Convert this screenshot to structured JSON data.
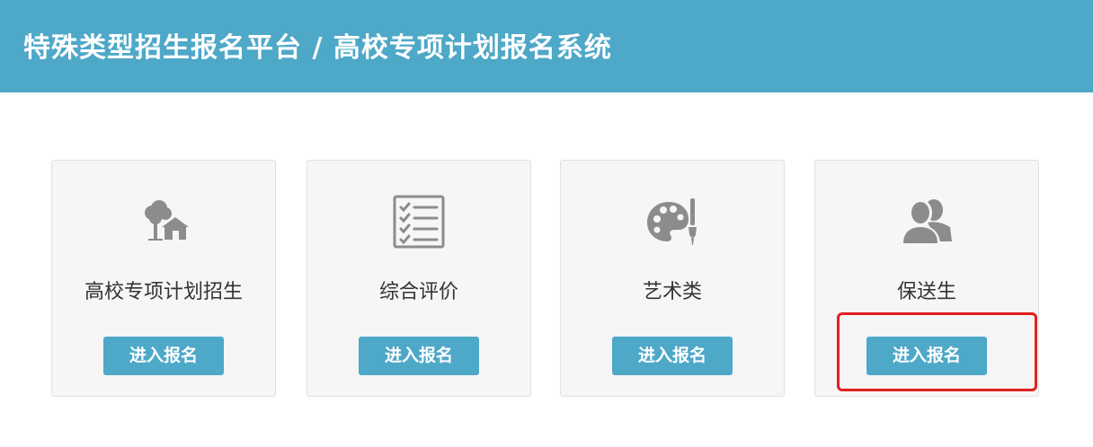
{
  "header": {
    "title": "特殊类型招生报名平台 / 高校专项计划报名系统",
    "background_color": "#4ea8c8"
  },
  "cards": [
    {
      "label": "高校专项计划招生",
      "icon": "tree-house-icon",
      "button_label": "进入报名"
    },
    {
      "label": "综合评价",
      "icon": "checklist-icon",
      "button_label": "进入报名"
    },
    {
      "label": "艺术类",
      "icon": "palette-icon",
      "button_label": "进入报名"
    },
    {
      "label": "保送生",
      "icon": "users-icon",
      "button_label": "进入报名",
      "highlighted": true
    }
  ],
  "colors": {
    "accent": "#4ea8c8",
    "highlight": "#e02020",
    "icon": "#8c8c8c",
    "card_background": "#f6f6f6"
  }
}
